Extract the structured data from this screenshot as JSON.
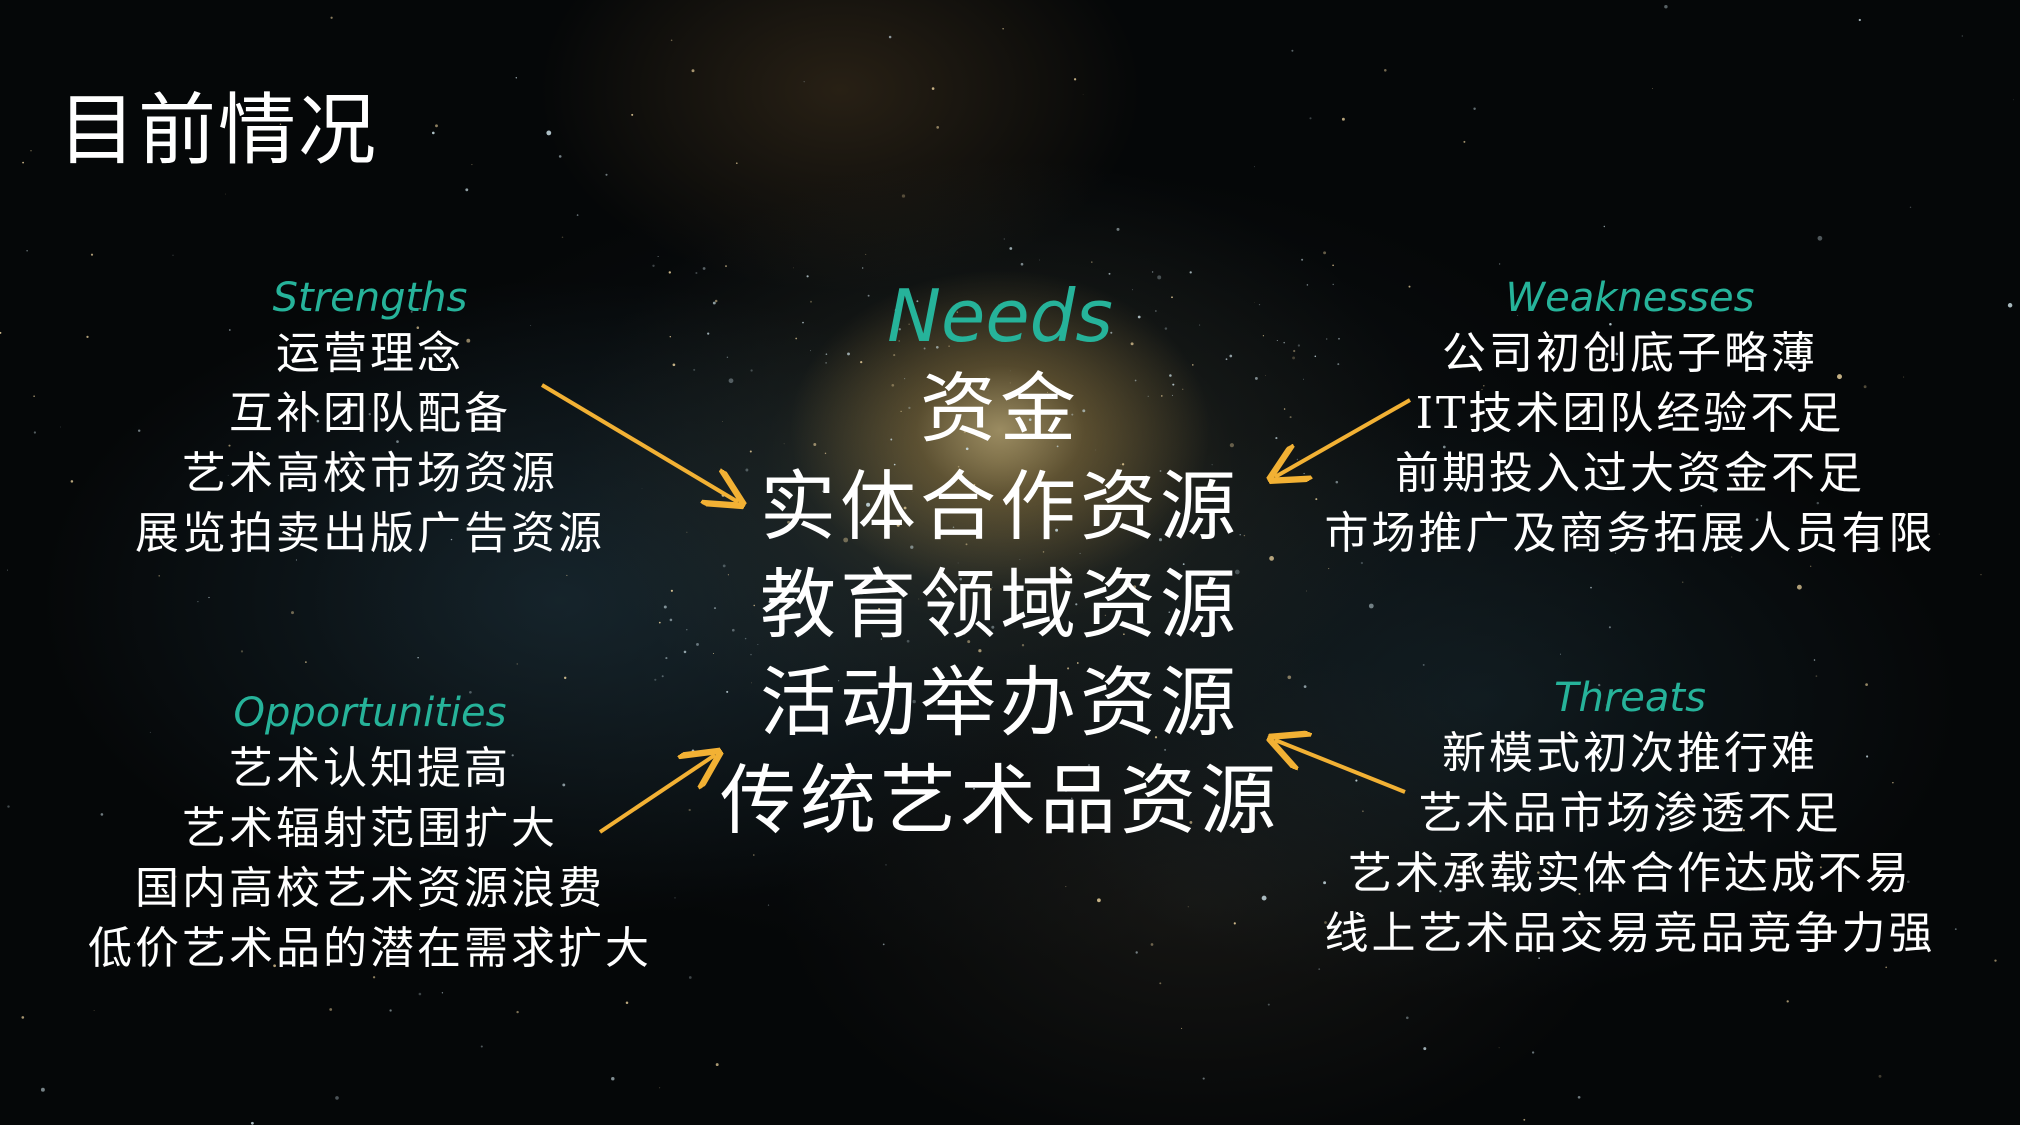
{
  "page_title": "目前情况",
  "needs": {
    "heading": "Needs",
    "items": [
      "资金",
      "实体合作资源",
      "教育领域资源",
      "活动举办资源",
      "传统艺术品资源"
    ]
  },
  "strengths": {
    "heading": "Strengths",
    "items": [
      "运营理念",
      "互补团队配备",
      "艺术高校市场资源",
      "展览拍卖出版广告资源"
    ]
  },
  "weaknesses": {
    "heading": "Weaknesses",
    "items": [
      "公司初创底子略薄",
      "IT技术团队经验不足",
      "前期投入过大资金不足",
      "市场推广及商务拓展人员有限"
    ]
  },
  "opportunities": {
    "heading": "Opportunities",
    "items": [
      "艺术认知提高",
      "艺术辐射范围扩大",
      "国内高校艺术资源浪费",
      "低价艺术品的潜在需求扩大"
    ]
  },
  "threats": {
    "heading": "Threats",
    "items": [
      "新模式初次推行难",
      "艺术品市场渗透不足",
      "艺术承载实体合作达成不易",
      "线上艺术品交易竞品竞争力强"
    ]
  },
  "colors": {
    "heading_accent": "#26b39a",
    "arrow": "#f2b134",
    "text": "#ffffff"
  },
  "icons": [
    "arrow-icon"
  ]
}
